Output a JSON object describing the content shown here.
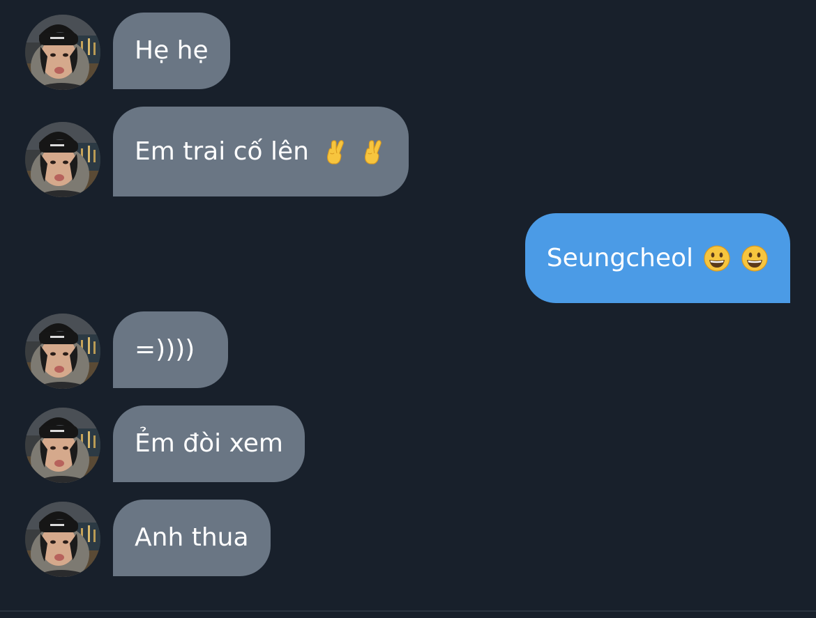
{
  "messages": [
    {
      "direction": "incoming",
      "text": "Hẹ hẹ",
      "emoji": []
    },
    {
      "direction": "incoming",
      "text": "Em trai cố lên",
      "emoji": [
        "crossed-fingers-emoji",
        "crossed-fingers-emoji"
      ]
    },
    {
      "direction": "outgoing",
      "text": "Seungcheol",
      "emoji": [
        "grinning-face-emoji",
        "grinning-face-emoji"
      ]
    },
    {
      "direction": "incoming",
      "text": "=))))",
      "emoji": []
    },
    {
      "direction": "incoming",
      "text": "Ẻm đòi xem",
      "emoji": []
    },
    {
      "direction": "incoming",
      "text": "Anh thua",
      "emoji": []
    }
  ],
  "colors": {
    "background": "#18202b",
    "incoming_bubble": "#6a7684",
    "outgoing_bubble": "#4b9be6",
    "text": "#ffffff"
  }
}
